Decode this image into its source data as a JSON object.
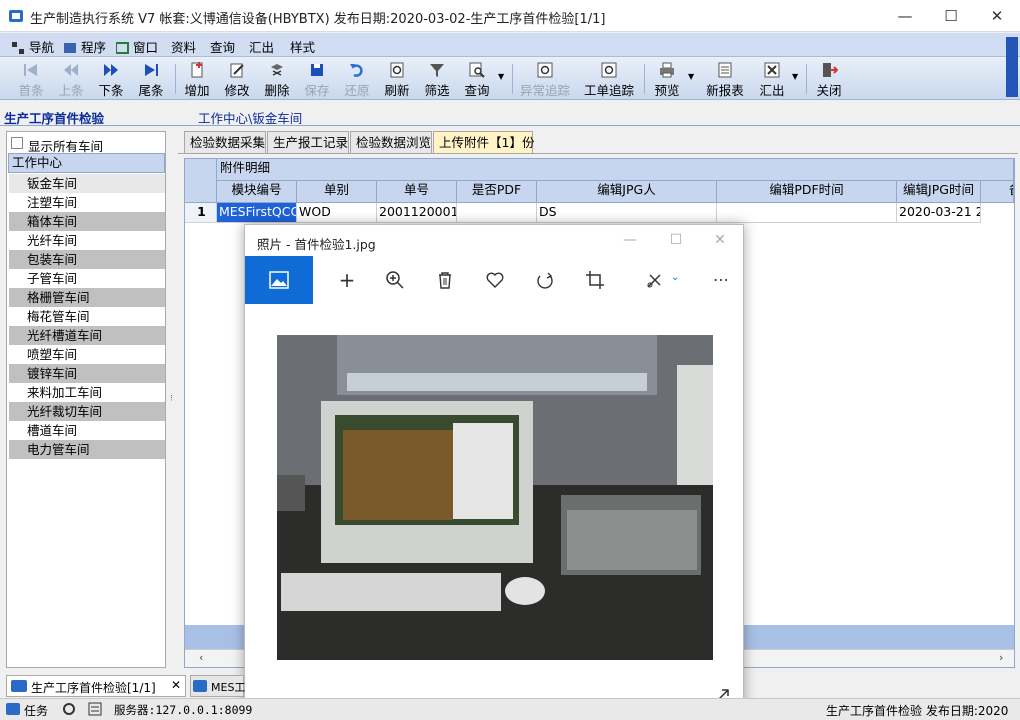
{
  "window": {
    "title": "生产制造执行系统 V7 帐套:义博通信设备(HBYBTX) 发布日期:2020-03-02-生产工序首件检验[1/1]",
    "minimize": "—",
    "maximize": "☐",
    "close": "✕"
  },
  "menubar": [
    "导航",
    "程序",
    "窗口",
    "资料",
    "查询",
    "汇出",
    "样式"
  ],
  "toolbar": {
    "first": "首条",
    "prev": "上条",
    "next": "下条",
    "last": "尾条",
    "add": "增加",
    "edit": "修改",
    "delete": "删除",
    "save": "保存",
    "undo": "还原",
    "refresh": "刷新",
    "filter": "筛选",
    "query": "查询",
    "abnormal": "异常追踪",
    "worktrack": "工单追踪",
    "preview": "预览",
    "newreport": "新报表",
    "export": "汇出",
    "close": "关闭"
  },
  "module_title": "生产工序首件检验",
  "breadcrumb": "工作中心\\钣金车间",
  "left_panel": {
    "show_all_label": "显示所有车间",
    "header": "工作中心",
    "items": [
      "钣金车间",
      "注塑车间",
      "箱体车间",
      "光纤车间",
      "包装车间",
      "子管车间",
      "格栅管车间",
      "梅花管车间",
      "光纤槽道车间",
      "喷塑车间",
      "镀锌车间",
      "来料加工车间",
      "光纤裁切车间",
      "槽道车间",
      "电力管车间"
    ]
  },
  "tabs": [
    "检验数据采集",
    "生产报工记录",
    "检验数据浏览",
    "上传附件【1】份"
  ],
  "grid": {
    "group_header": "附件明细",
    "columns": [
      "模块编号",
      "单别",
      "单号",
      "是否PDF",
      "编辑JPG人",
      "编辑PDF时间",
      "编辑JPG时间",
      "备"
    ],
    "rows": [
      {
        "index": "1",
        "module": "MESFirstQCC",
        "type": "WOD",
        "number": "2001120001",
        "pdf": "",
        "jpg_user": "DS",
        "pdf_time": "",
        "jpg_time": "2020-03-21 20"
      }
    ]
  },
  "photo_window": {
    "title": "照片 - 首件检验1.jpg"
  },
  "bottom_tabs": [
    "生产工序首件检验[1/1]",
    "MES工"
  ],
  "status": {
    "task": "任务",
    "server": "服务器:127.0.0.1:8099",
    "right": "生产工序首件检验 发布日期:2020"
  }
}
